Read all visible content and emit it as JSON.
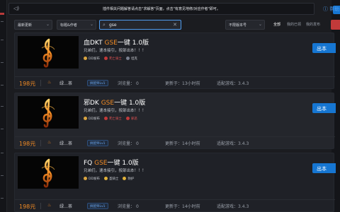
{
  "notice": {
    "text": "插件相关问题解答请点击\"求解答\"页面，点击\"有意见地修/对应作者\"即可。",
    "help_link": "帮助"
  },
  "filters": {
    "sort": "最新更新",
    "field": "标题&作者",
    "search_value": "gse",
    "version": "不限版本号"
  },
  "tabs": [
    "全部",
    "我的已领",
    "我的发布",
    "已收藏"
  ],
  "labels": {
    "views": "浏览量：",
    "updated": "更新于：",
    "game": "适配游戏："
  },
  "cards": [
    {
      "prefix": "血DKT ",
      "highlight": "GSE",
      "suffix": "一键 1.0版",
      "desc": "兄弟们，速本接引，按部出本！！！",
      "badges": [
        {
          "text": "DD发布",
          "dot_color": "#d9a441",
          "alert": false
        },
        {
          "text": "死亡骑士",
          "dot_color": "#c23a3a",
          "alert": true
        },
        {
          "text": "坦克",
          "dot_color": "#7a8090",
          "alert": false
        }
      ],
      "price": "198元",
      "author": "绿…茶",
      "level": "搞配师Lv1",
      "views": "0",
      "updated": "13小时前",
      "game_version": "3.4.3",
      "get_label": "出本"
    },
    {
      "prefix": "邪DK ",
      "highlight": "GSE",
      "suffix": "一键 1.0版",
      "desc": "兄弟们，速本接引，按部出本！！！",
      "badges": [
        {
          "text": "DD发布",
          "dot_color": "#d9a441",
          "alert": false
        },
        {
          "text": "死亡骑士",
          "dot_color": "#c23a3a",
          "alert": true
        },
        {
          "text": "邪恶",
          "dot_color": "#c23a3a",
          "alert": true
        }
      ],
      "price": "198元",
      "author": "绿…茶",
      "level": "搞配师Lv1",
      "views": "0",
      "updated": "14小时前",
      "game_version": "3.4.3",
      "get_label": "出本"
    },
    {
      "prefix": "FQ ",
      "highlight": "GSE",
      "suffix": "一键 1.0版",
      "desc": "兄弟们，速本接引，按部出本！！！",
      "badges": [
        {
          "text": "DD发布",
          "dot_color": "#d9a441",
          "alert": false
        },
        {
          "text": "圣骑士",
          "dot_color": "#e0b13a",
          "alert": false
        },
        {
          "text": "防护",
          "dot_color": "#e0b13a",
          "alert": false
        }
      ],
      "price": "198元",
      "author": "绿…茶",
      "level": "搞配师Lv1",
      "views": "0",
      "updated": "14小时前",
      "game_version": "3.4.3",
      "get_label": "出本"
    }
  ]
}
